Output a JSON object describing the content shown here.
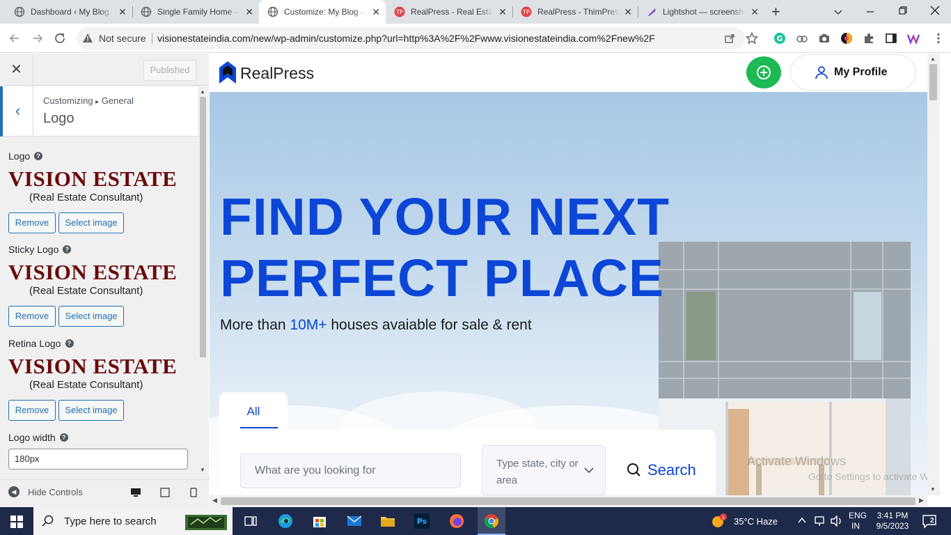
{
  "browser": {
    "tabs": [
      {
        "label": "Dashboard ‹ My Blog — WordPress"
      },
      {
        "label": "Single Family Home – RealPress"
      },
      {
        "label": "Customize: My Blog – Just another"
      },
      {
        "label": "RealPress - Real Estate WordPress"
      },
      {
        "label": "RealPress - ThimPress"
      },
      {
        "label": "Lightshot — screenshot tool"
      }
    ],
    "new_tab": "+",
    "not_secure": "Not secure",
    "url": "visionestateindia.com/new/wp-admin/customize.php?url=http%3A%2F%2Fwww.visionestateindia.com%2Fnew%2F"
  },
  "customizer": {
    "published": "Published",
    "breadcrumb_root": "Customizing",
    "breadcrumb_arrow": "▸",
    "breadcrumb_section": "General",
    "section_title": "Logo",
    "fields": [
      {
        "label": "Logo",
        "logo_main": "VISION ESTATE",
        "logo_sub": "(Real Estate Consultant)",
        "remove": "Remove",
        "select": "Select image"
      },
      {
        "label": "Sticky Logo",
        "logo_main": "VISION ESTATE",
        "logo_sub": "(Real Estate Consultant)",
        "remove": "Remove",
        "select": "Select image"
      },
      {
        "label": "Retina Logo",
        "logo_main": "VISION ESTATE",
        "logo_sub": "(Real Estate Consultant)",
        "remove": "Remove",
        "select": "Select image"
      }
    ],
    "logo_width_label": "Logo width",
    "logo_width_value": "180px",
    "hide_controls": "Hide Controls"
  },
  "site": {
    "brand": "RealPress",
    "my_profile": "My Profile",
    "headline_1": "FIND YOUR NEXT",
    "headline_2": "PERFECT PLACE",
    "sub_prefix": "More than ",
    "sub_highlight": "10M+",
    "sub_suffix": " houses avaiable for sale & rent",
    "tab_all": "All",
    "search_placeholder": "What are you looking for",
    "location_placeholder": "Type state, city or area",
    "search_button": "Search",
    "accent": "#0b46d6",
    "add_button_color": "#1db954"
  },
  "watermark": {
    "line1": "Activate Windows",
    "line2": "Go to Settings to activate Windows."
  },
  "taskbar": {
    "search_placeholder": "Type here to search",
    "weather": "35°C  Haze",
    "lang_1": "ENG",
    "lang_2": "IN",
    "time": "3:41 PM",
    "date": "9/5/2023",
    "notifications": "2"
  }
}
